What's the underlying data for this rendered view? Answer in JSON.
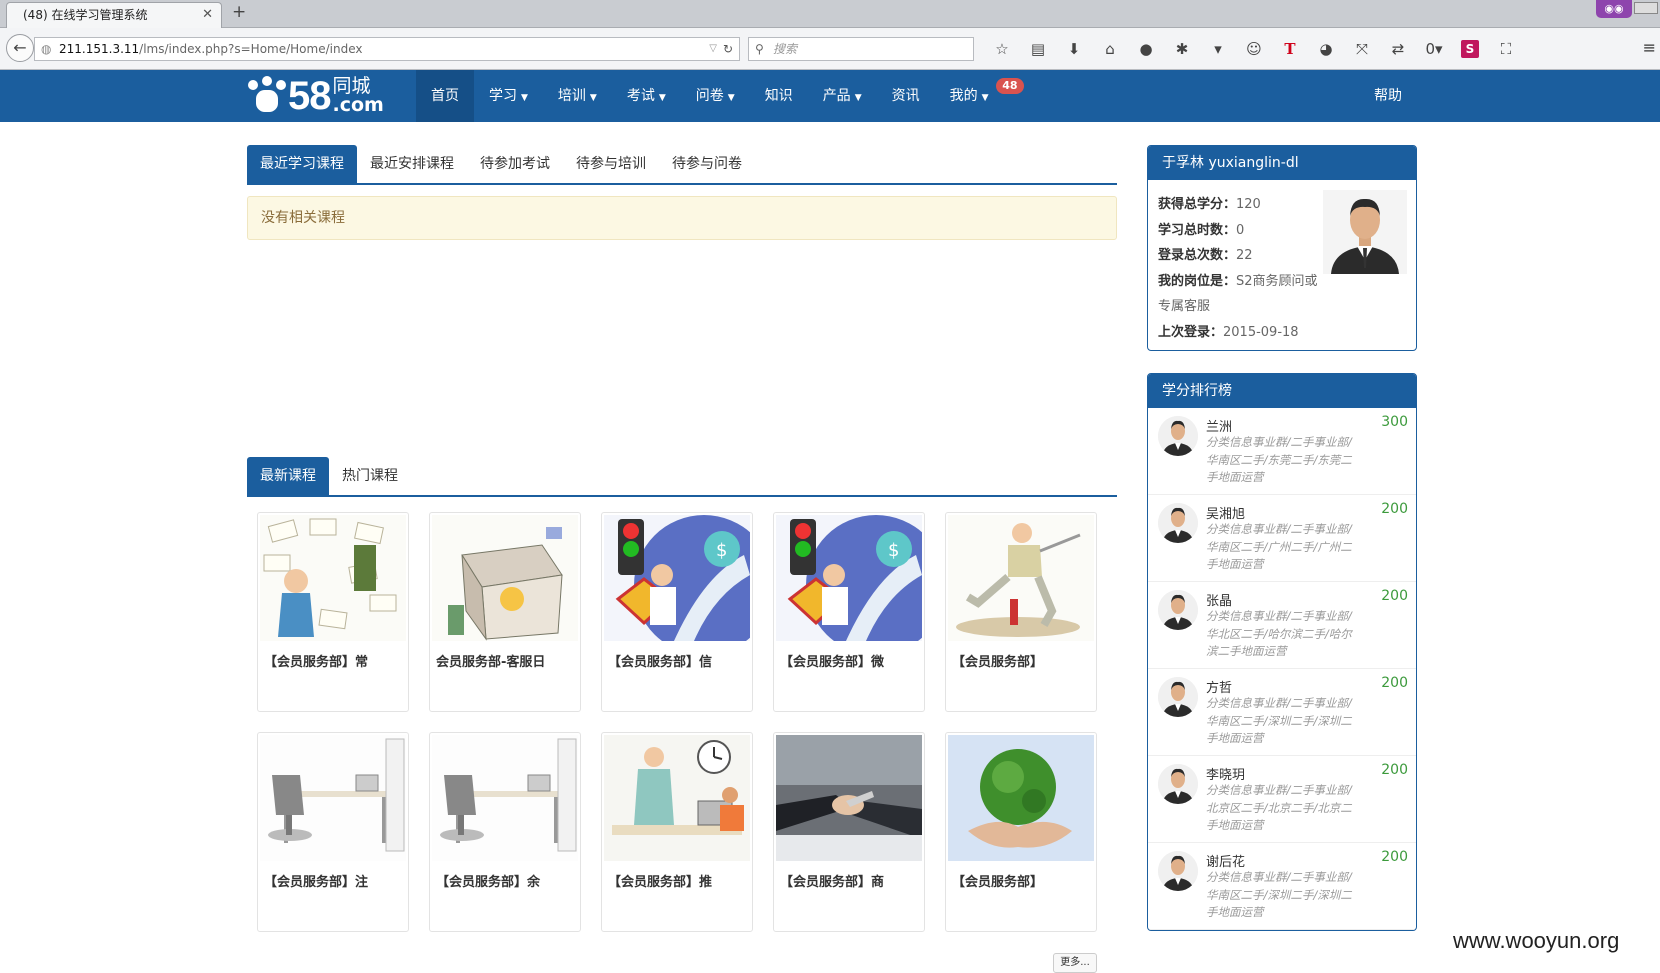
{
  "browser": {
    "tab_title": "(48) 在线学习管理系统",
    "url_host": "211.151.3.11",
    "url_path": "/lms/index.php?s=Home/Home/index",
    "search_placeholder": "搜索",
    "toolbar_t_label": "T",
    "toolbar_s_label": "S",
    "toolbar_count": "0"
  },
  "header": {
    "logo_num": "58",
    "logo_cn_top": "同城",
    "logo_cn_bottom": ".com",
    "nav": [
      {
        "label": "首页",
        "active": true
      },
      {
        "label": "学习",
        "caret": true
      },
      {
        "label": "培训",
        "caret": true
      },
      {
        "label": "考试",
        "caret": true
      },
      {
        "label": "问卷",
        "caret": true
      },
      {
        "label": "知识"
      },
      {
        "label": "产品",
        "caret": true
      },
      {
        "label": "资讯"
      },
      {
        "label": "我的",
        "caret": true,
        "badge": "48"
      }
    ],
    "help": "帮助"
  },
  "main": {
    "tabs_top": [
      "最近学习课程",
      "最近安排课程",
      "待参加考试",
      "待参与培训",
      "待参与问卷"
    ],
    "empty_msg": "没有相关课程",
    "tabs_bottom": [
      "最新课程",
      "热门课程"
    ],
    "courses": [
      {
        "title": "【会员服务部】常",
        "thumb": "envelopes"
      },
      {
        "title": "会员服务部-客服日",
        "thumb": "box"
      },
      {
        "title": "【会员服务部】信",
        "thumb": "traffic"
      },
      {
        "title": "【会员服务部】微",
        "thumb": "traffic"
      },
      {
        "title": "【会员服务部】",
        "thumb": "runner"
      },
      {
        "title": "【会员服务部】注",
        "thumb": "desk"
      },
      {
        "title": "【会员服务部】余",
        "thumb": "desk"
      },
      {
        "title": "【会员服务部】推",
        "thumb": "clock"
      },
      {
        "title": "【会员服务部】商",
        "thumb": "handshake"
      },
      {
        "title": "【会员服务部】",
        "thumb": "globe"
      }
    ],
    "more": "更多..."
  },
  "profile": {
    "name": "于孚林 yuxianglin-dl",
    "credits_label": "获得总学分：",
    "credits": "120",
    "hours_label": "学习总时数：",
    "hours": "0",
    "logins_label": "登录总次数：",
    "logins": "22",
    "post_label": "我的岗位是：",
    "post": "S2商务顾问或专属客服",
    "last_label": "上次登录：",
    "last": "2015-09-18"
  },
  "ranking": {
    "title": "学分排行榜",
    "items": [
      {
        "name": "兰洲",
        "dept": "分类信息事业群/二手事业部/华南区二手/东莞二手/东莞二手地面运营",
        "score": "300"
      },
      {
        "name": "吴湘旭",
        "dept": "分类信息事业群/二手事业部/华南区二手/广州二手/广州二手地面运营",
        "score": "200"
      },
      {
        "name": "张晶",
        "dept": "分类信息事业群/二手事业部/华北区二手/哈尔滨二手/哈尔滨二手地面运营",
        "score": "200"
      },
      {
        "name": "方哲",
        "dept": "分类信息事业群/二手事业部/华南区二手/深圳二手/深圳二手地面运营",
        "score": "200"
      },
      {
        "name": "李晓玥",
        "dept": "分类信息事业群/二手事业部/北京区二手/北京二手/北京二手地面运营",
        "score": "200"
      },
      {
        "name": "谢后花",
        "dept": "分类信息事业群/二手事业部/华南区二手/深圳二手/深圳二手地面运营",
        "score": "200"
      }
    ]
  },
  "watermark": "www.wooyun.org"
}
